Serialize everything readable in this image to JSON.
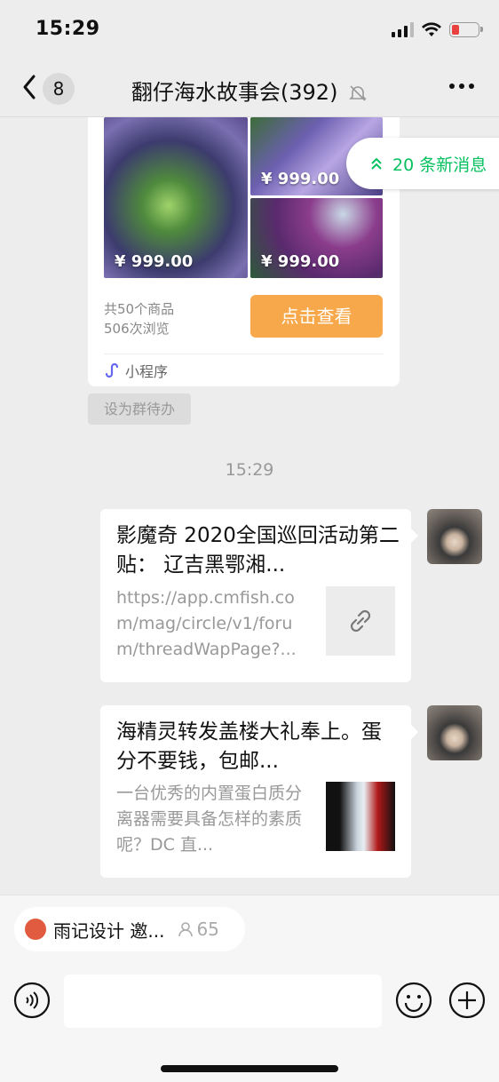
{
  "status_bar": {
    "time": "15:29"
  },
  "header": {
    "back_badge": "8",
    "title": "翻仔海水故事会(392)"
  },
  "new_messages": {
    "label": "20 条新消息"
  },
  "product_card": {
    "prices": [
      "¥ 999.00",
      "¥ 999.00",
      "¥ 999.00"
    ],
    "count": "共50个商品",
    "views": "506次浏览",
    "button": "点击查看",
    "source": "小程序"
  },
  "set_todo": "设为群待办",
  "timestamp": "15:29",
  "messages": [
    {
      "title": "影魔奇 2020全国巡回活动第二贴： 辽吉黑鄂湘...",
      "desc": "https://app.cmfish.com/mag/circle/v1/forum/threadWapPage?..."
    },
    {
      "title": "海精灵转发盖楼大礼奉上。蛋分不要钱，包邮...",
      "desc": "一台优秀的内置蛋白质分离器需要具备怎样的素质呢？DC 直..."
    }
  ],
  "chip": {
    "label": "雨记设计 邀...",
    "count": "65"
  },
  "colors": {
    "accent_green": "#07c160",
    "button_orange": "#f7a84a",
    "background": "#ededed"
  }
}
